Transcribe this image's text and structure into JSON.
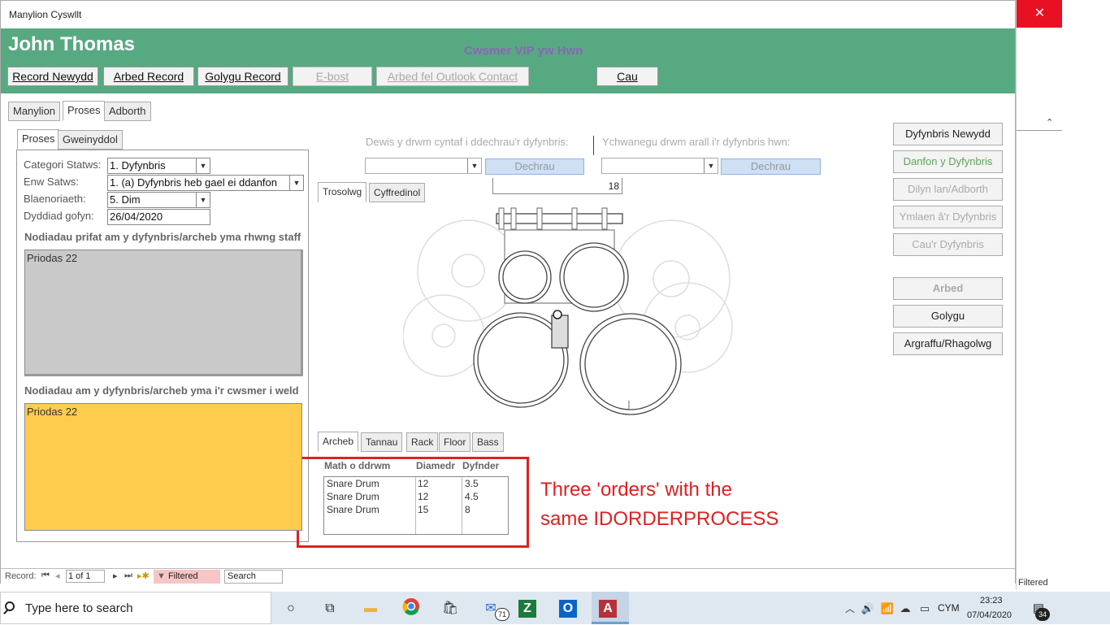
{
  "window": {
    "title": "Manylion Cyswllt"
  },
  "background_window": {
    "close_glyph": "✕",
    "status_text": "Filtered",
    "scroll_glyph": "⌃"
  },
  "header": {
    "name": "John Thomas",
    "vip_text": "Cwsmer VIP yw Hwn",
    "buttons": {
      "new_record": "Record Newydd",
      "save_record": "Arbed Record",
      "edit_record": "Golygu Record",
      "email": "E-bost",
      "save_outlook": "Arbed fel Outlook Contact",
      "close": "Cau"
    }
  },
  "tabs": {
    "manylion": "Manylion",
    "proses": "Proses",
    "adborth": "Adborth"
  },
  "subtabs": {
    "proses": "Proses",
    "gweinyddol": "Gweinyddol"
  },
  "form": {
    "status_category_label": "Categori Statws:",
    "status_category_value": "1. Dyfynbris",
    "status_name_label": "Enw Satws:",
    "status_name_value": "1. (a) Dyfynbris heb gael ei ddanfon",
    "priority_label": "Blaenoriaeth:",
    "priority_value": "5. Dim",
    "date_label": "Dyddiad gofyn:",
    "date_value": "26/04/2020",
    "private_notes_title": "Nodiadau prifat am y dyfynbris/archeb yma rhwng staff",
    "private_notes": "Priodas 22",
    "customer_notes_title": "Nodiadau am y dyfynbris/archeb yma i'r cwsmer i weld",
    "customer_notes": "Priodas 22"
  },
  "drum": {
    "choose_label": "Dewis y drwm cyntaf i ddechrau'r dyfynbris:",
    "add_label": "Ychwanegu drwm arall i'r dyfynbris hwn:",
    "start_button": "Dechrau",
    "start_button2": "Dechrau",
    "count": "18",
    "tabs": {
      "trosolwg": "Trosolwg",
      "cyffredinol": "Cyffredinol"
    }
  },
  "order_tabs": {
    "archeb": "Archeb",
    "tannau": "Tannau",
    "rack": "Rack",
    "floor": "Floor",
    "bass": "Bass"
  },
  "orders": {
    "headers": {
      "type": "Math o ddrwm",
      "diameter": "Diamedr",
      "depth": "Dyfnder"
    },
    "rows": [
      {
        "type": "Snare Drum",
        "diameter": "12",
        "depth": "3.5"
      },
      {
        "type": "Snare Drum",
        "diameter": "12",
        "depth": "4.5"
      },
      {
        "type": "Snare Drum",
        "diameter": "15",
        "depth": "8"
      }
    ]
  },
  "annotation": {
    "line1": "Three 'orders' with the",
    "line2": "same IDORDERPROCESS",
    "color": "#e02020"
  },
  "side_buttons": {
    "new_quote": "Dyfynbris Newydd",
    "send_quote": "Danfon y Dyfynbris",
    "follow_up": "Dilyn lan/Adborth",
    "extend_quote": "Ymlaen â'r Dyfynbris",
    "close_quote": "Cau'r Dyfynbris",
    "save": "Arbed",
    "edit": "Golygu",
    "print_preview": "Argraffu/Rhagolwg"
  },
  "statusbar": {
    "record_label": "Record:",
    "position": "1 of 1",
    "filtered": "Filtered",
    "search": "Search"
  },
  "taskbar": {
    "search_placeholder": "Type here to search",
    "mail_badge": "71",
    "language": "CYM",
    "time": "23:23",
    "date": "07/04/2020",
    "notification_count": "34"
  },
  "colors": {
    "header_green": "#57a982",
    "vip_purple": "#8a66b3",
    "gray_notes": "#c9c9c9",
    "yellow_notes": "#ffcc4d",
    "annotation_red": "#e02020"
  }
}
